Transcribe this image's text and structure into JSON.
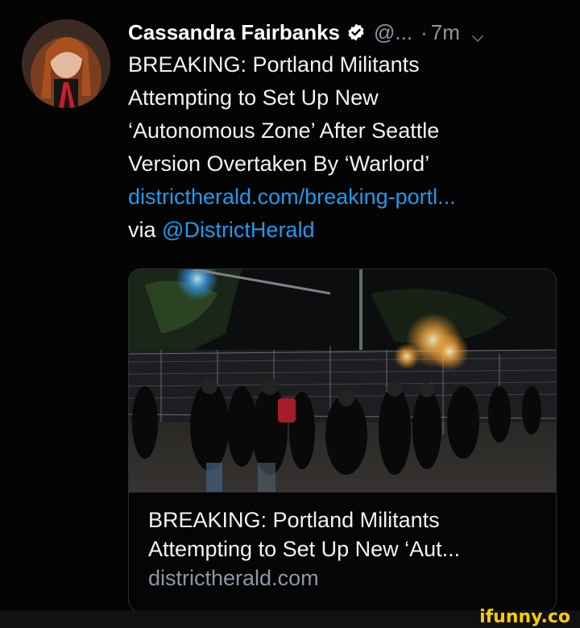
{
  "tweet": {
    "author_name": "Cassandra Fairbanks",
    "handle": "@...",
    "time": "7m",
    "verified": true,
    "lines": [
      "BREAKING: Portland Militants",
      "Attempting to Set Up New",
      "‘Autonomous Zone’ After Seattle",
      "Version Overtaken By ‘Warlord’"
    ],
    "link_url": "districtherald.com/breaking-portl...",
    "via_prefix": "via ",
    "via_mention": "@DistrictHerald"
  },
  "card": {
    "title_line1": "BREAKING: Portland Militants",
    "title_line2": "Attempting to Set Up New ‘Aut...",
    "domain": "districtherald.com"
  },
  "watermark": {
    "logo_text": "ifunny.co"
  },
  "colors": {
    "background": "#040404",
    "link": "#1d9bf0",
    "muted": "#8b98a5",
    "verified": "#ffffff",
    "watermark": "#ffcc00"
  },
  "icons": {
    "verified": "verified-badge-icon",
    "menu": "chevron-down-icon"
  }
}
